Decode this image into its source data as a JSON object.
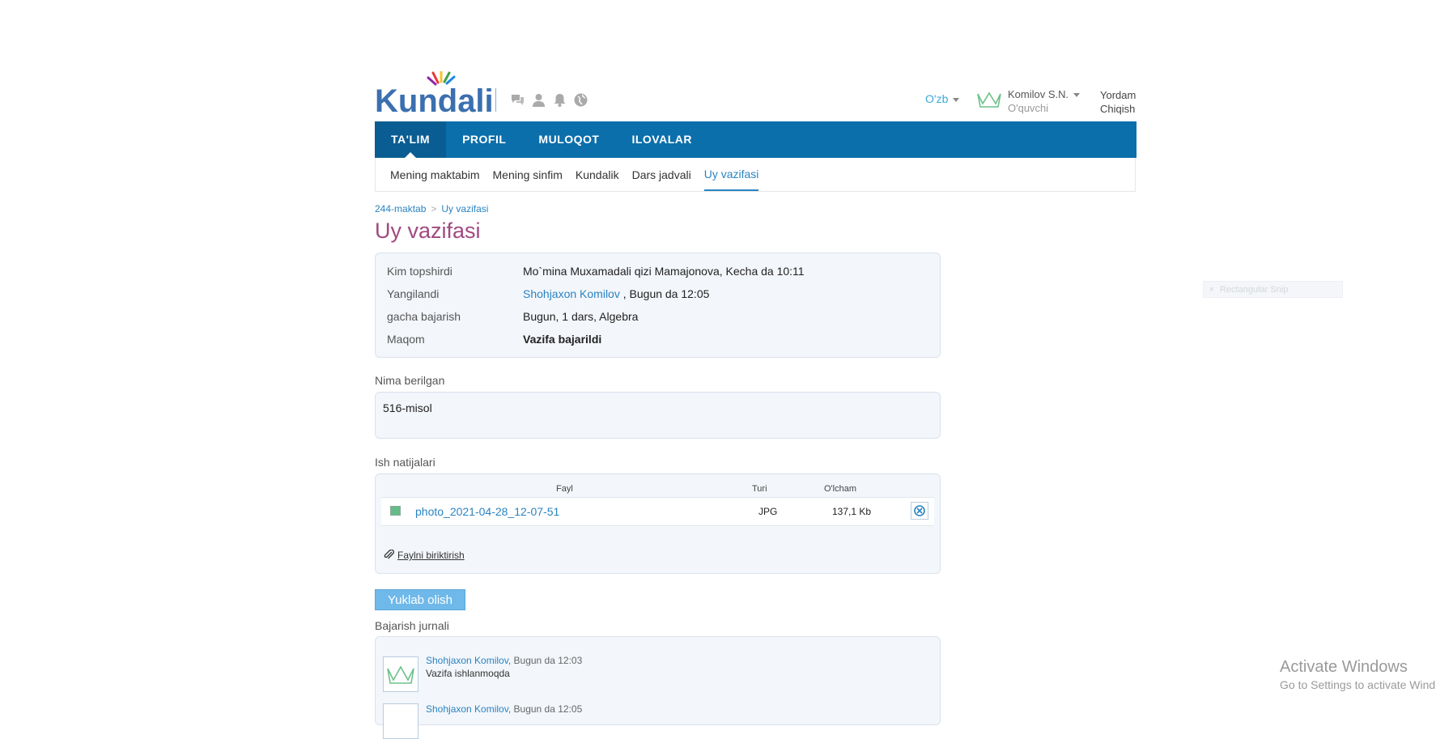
{
  "header": {
    "logo_text": "Kundalik",
    "icons": [
      "chat-icon",
      "user-icon",
      "bell-icon",
      "globe-icon"
    ],
    "language": "O'zb",
    "user_name": "Komilov S.N.",
    "user_role": "O'quvchi",
    "help": "Yordam",
    "logout": "Chiqish"
  },
  "mainnav": [
    "TA'LIM",
    "PROFIL",
    "MULOQOT",
    "ILOVALAR"
  ],
  "subnav": [
    "Mening maktabim",
    "Mening sinfim",
    "Kundalik",
    "Dars jadvali",
    "Uy vazifasi"
  ],
  "breadcrumb": [
    "244-maktab",
    "Uy vazifasi"
  ],
  "page_title": "Uy vazifasi",
  "info": {
    "submitted_label": "Kim topshirdi",
    "submitted_value": "Mo`mina Muxamadali qizi Mamajonova, Kecha da 10:11",
    "updated_label": "Yangilandi",
    "updated_link": "Shohjaxon Komilov",
    "updated_time": " , Bugun da 12:05",
    "due_label": "gacha bajarish",
    "due_value": "Bugun, 1 dars, Algebra",
    "status_label": "Maqom",
    "status_value": "Vazifa bajarildi"
  },
  "given": {
    "label": "Nima berilgan",
    "text": "516-misol"
  },
  "results": {
    "label": "Ish natijalari",
    "col_file": "Fayl",
    "col_type": "Turi",
    "col_size": "O'lcham",
    "files": [
      {
        "name": "photo_2021-04-28_12-07-51",
        "type": "JPG",
        "size": "137,1 Kb"
      }
    ],
    "attach": "Faylni biriktirish"
  },
  "download": "Yuklab olish",
  "log": {
    "label": "Bajarish jurnali",
    "entries": [
      {
        "author": "Shohjaxon Komilov",
        "time": ", Bugun da 12:03",
        "message": "Vazifa ishlanmoqda"
      },
      {
        "author": "Shohjaxon Komilov",
        "time": ", Bugun da 12:05",
        "message": ""
      }
    ]
  },
  "snip": "Rectangular Snip",
  "windows": {
    "line1": "Activate Windows",
    "line2": "Go to Settings to activate Windows."
  },
  "colors": {
    "nav_blue": "#0b6fab",
    "title_purple": "#a0497f",
    "link_blue": "#2a84c2"
  }
}
